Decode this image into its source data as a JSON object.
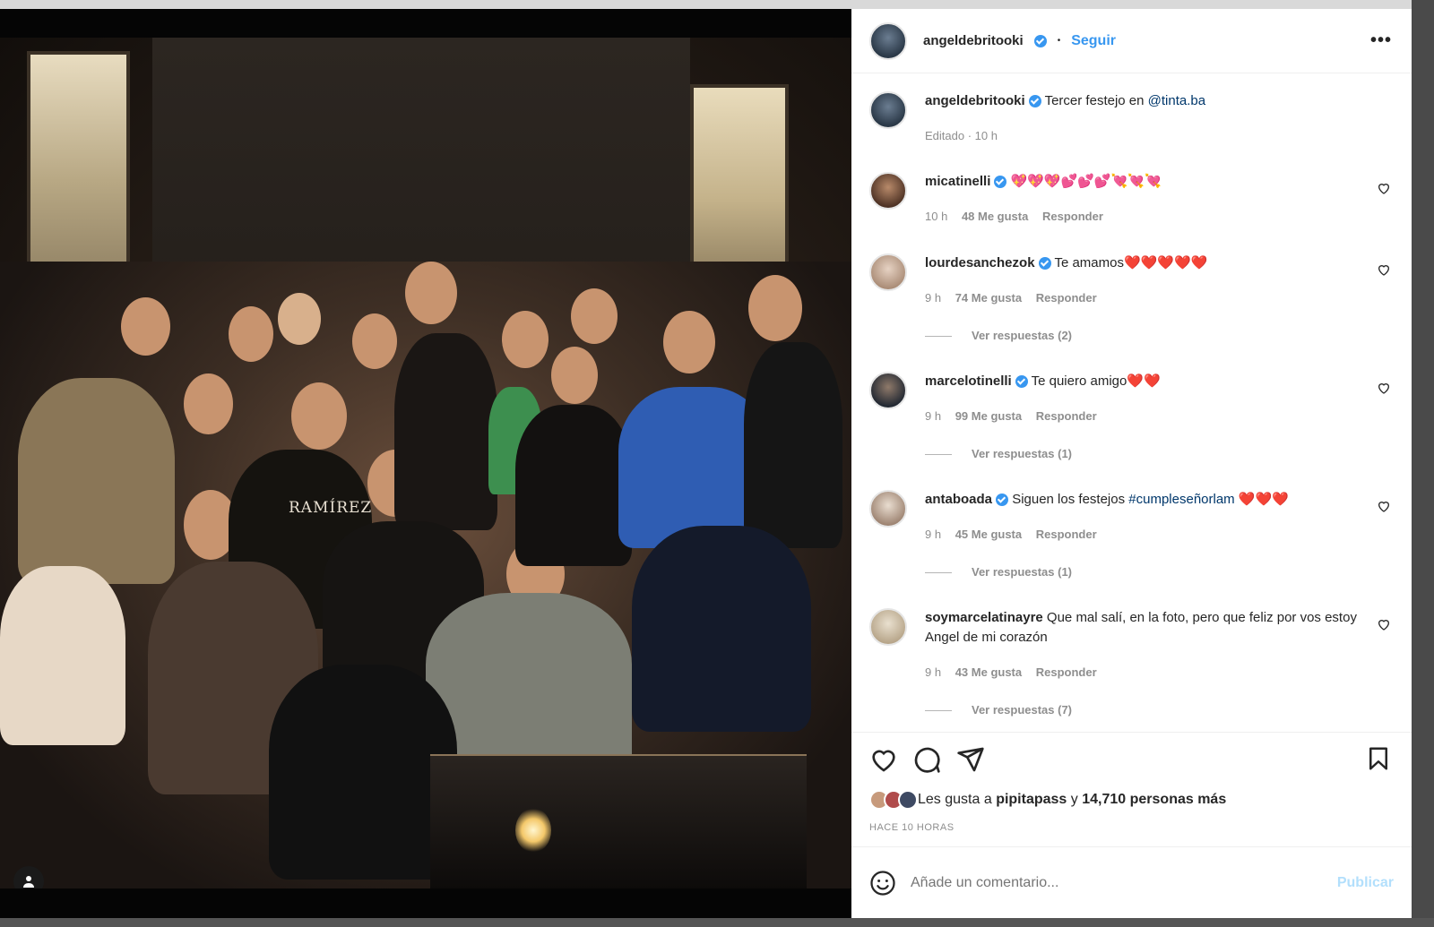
{
  "post": {
    "author": "angeldebritooki",
    "follow_label": "Seguir",
    "dot": "•",
    "more_label": "•••",
    "caption_author": "angeldebritooki",
    "caption_text": "Tercer festejo en",
    "caption_mention": "@tinta.ba",
    "caption_meta": "Editado · 10 h",
    "photo_shirt_text": "RAMÍREZ"
  },
  "comments": [
    {
      "user": "micatinelli",
      "text": "",
      "emoji": "💖💖💖💕💕💕💘💘💘",
      "time": "10 h",
      "likes": "48 Me gusta",
      "reply": "Responder",
      "replies": ""
    },
    {
      "user": "lourdesanchezok",
      "text": "Te amamos",
      "emoji": "❤️❤️❤️❤️❤️",
      "time": "9 h",
      "likes": "74 Me gusta",
      "reply": "Responder",
      "replies": "Ver respuestas (2)"
    },
    {
      "user": "marcelotinelli",
      "text": "Te quiero amigo",
      "emoji": "❤️❤️",
      "time": "9 h",
      "likes": "99 Me gusta",
      "reply": "Responder",
      "replies": "Ver respuestas (1)"
    },
    {
      "user": "antaboada",
      "text": "Siguen los festejos",
      "hashtag": "#cumpleseñorlam",
      "emoji": "❤️❤️❤️",
      "time": "9 h",
      "likes": "45 Me gusta",
      "reply": "Responder",
      "replies": "Ver respuestas (1)"
    },
    {
      "user": "soymarcelatinayre",
      "text": "Que mal salí, en la foto, pero que feliz por vos estoy Angel de mi corazón",
      "time": "9 h",
      "likes": "43 Me gusta",
      "reply": "Responder",
      "replies": "Ver respuestas (7)"
    }
  ],
  "likes": {
    "prefix": "Les gusta a",
    "user": "pipitapass",
    "joiner": "y",
    "count": "14,710 personas más"
  },
  "time_ago": "HACE 10 HORAS",
  "add_comment": {
    "placeholder": "Añade un comentario...",
    "publish_label": "Publicar"
  },
  "colors": {
    "accent": "#3897f0",
    "heart_red": "#ed4956"
  }
}
